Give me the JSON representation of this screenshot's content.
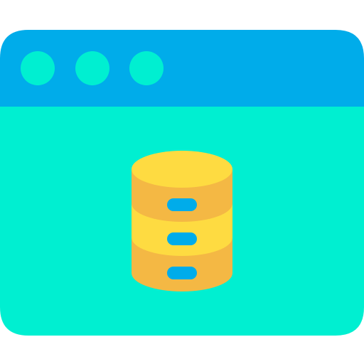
{
  "icon": {
    "name": "browser-database-icon",
    "window_dots": [
      "dot",
      "dot",
      "dot"
    ],
    "database_slots": [
      "slot",
      "slot",
      "slot"
    ]
  },
  "colors": {
    "title_bar": "#00ACEA",
    "window_body": "#00EFD1",
    "window_dot": "#00EFD1",
    "cylinder_top": "#FEDB41",
    "cylinder_band_dark": "#F4B844",
    "cylinder_band_light": "#FEDB41",
    "slot": "#00ACEA"
  }
}
